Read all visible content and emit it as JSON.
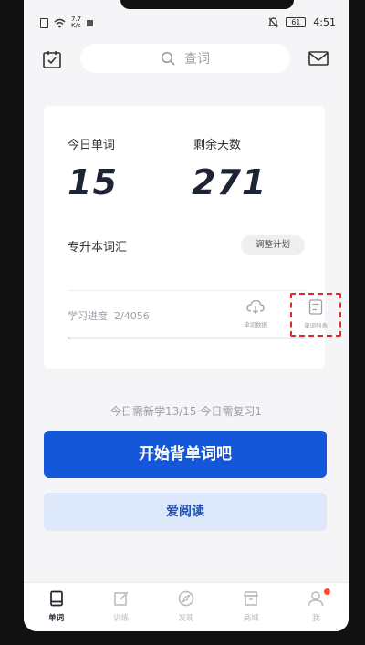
{
  "status_bar": {
    "speed_top": "7.7",
    "speed_bottom": "K/s",
    "battery": "61",
    "time": "4:51"
  },
  "header": {
    "search_placeholder": "查词",
    "icons": [
      "calendar-check-icon",
      "search-icon",
      "mail-icon"
    ]
  },
  "card": {
    "today_words_label": "今日单词",
    "today_words_value": "15",
    "days_left_label": "剩余天数",
    "days_left_value": "271",
    "book_name": "专升本词汇",
    "adjust_plan": "调整计划",
    "progress_label": "学习进度",
    "progress_value": "2/4056",
    "progress_fraction": 0.0005,
    "word_data_label": "单词数据",
    "word_list_label": "单词列表"
  },
  "today_summary": "今日需新学13/15  今日需复习1",
  "start_button": "开始背单词吧",
  "read_button": "爱阅读",
  "bottom_nav": [
    {
      "label": "单词",
      "icon": "book-icon",
      "active": true
    },
    {
      "label": "训练",
      "icon": "edit-icon",
      "active": false
    },
    {
      "label": "发现",
      "icon": "compass-icon",
      "active": false
    },
    {
      "label": "商城",
      "icon": "shop-icon",
      "active": false
    },
    {
      "label": "我",
      "icon": "user-icon",
      "active": false,
      "badge": true
    }
  ],
  "colors": {
    "primary": "#1557d9",
    "read_bg": "#dde8fb",
    "highlight": "#e02b2b"
  }
}
